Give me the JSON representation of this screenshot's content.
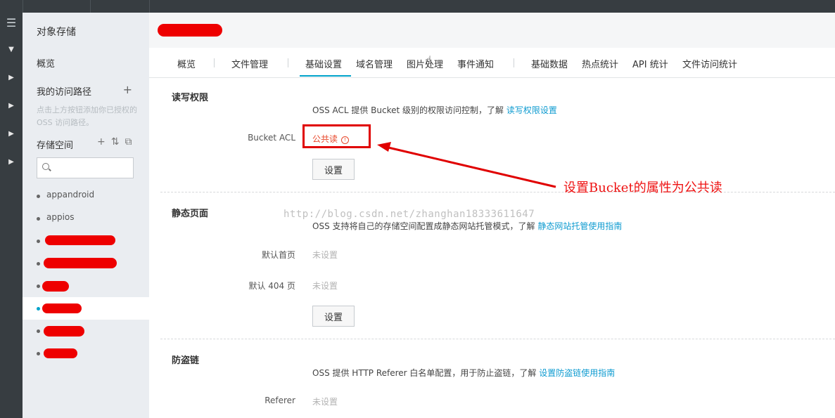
{
  "sidebar": {
    "title": "对象存储",
    "overview": "概览",
    "my_paths": "我的访问路径",
    "hint": "点击上方按钮添加你已授权的 OSS 访问路径。",
    "bucket_heading": "存储空间",
    "search": {
      "value": "",
      "placeholder": ""
    },
    "buckets": [
      "appandroid",
      "appios",
      "",
      "",
      "",
      "",
      "",
      ""
    ]
  },
  "tabs": [
    "概览",
    "文件管理",
    "基础设置",
    "域名管理",
    "图片处理",
    "事件通知",
    "基础数据",
    "热点统计",
    "API 统计",
    "文件访问统计"
  ],
  "acl_section": {
    "title": "读写权限",
    "desc": "OSS ACL 提供 Bucket 级别的权限访问控制，了解 ",
    "link": "读写权限设置",
    "label": "Bucket ACL",
    "value": "公共读",
    "button": "设置"
  },
  "static_section": {
    "title": "静态页面",
    "desc": "OSS 支持将自己的存储空间配置成静态网站托管模式，了解 ",
    "link": "静态网站托管使用指南",
    "index_label": "默认首页",
    "index_value": "未设置",
    "notfound_label": "默认 404 页",
    "notfound_value": "未设置",
    "button": "设置"
  },
  "referer_section": {
    "title": "防盗链",
    "desc": "OSS 提供 HTTP Referer 白名单配置，用于防止盗链，了解 ",
    "link": "设置防盗链使用指南",
    "label": "Referer",
    "value": "未设置"
  },
  "annotation": "设置Bucket的属性为公共读",
  "watermark": "http://blog.csdn.net/zhanghan18333611647",
  "colors": {
    "accent": "#00a2ca",
    "link": "#0e9bd0",
    "annotation": "#ee1111",
    "sidebar_bg": "#eaedf1",
    "dark_bar": "#373d41"
  },
  "icons": [
    "menu-icon",
    "plus-icon",
    "sort-icon",
    "refresh-icon",
    "search-icon",
    "info-icon",
    "pointer-cursor-icon"
  ]
}
